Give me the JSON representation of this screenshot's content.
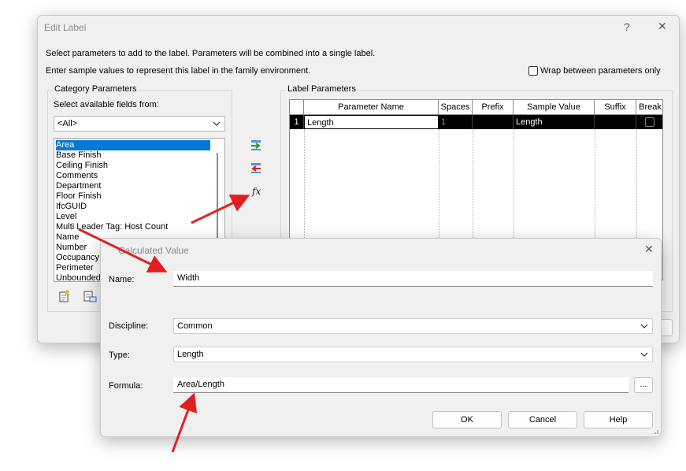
{
  "edit_label": {
    "title": "Edit Label",
    "help": "?",
    "close": "✕",
    "instruction1": "Select parameters to add to the label.  Parameters will be combined into a single label.",
    "instruction2": "Enter sample values to represent this label in the family environment.",
    "wrap_label": "Wrap between parameters only",
    "category_group": "Category Parameters",
    "select_fields_label": "Select available fields from:",
    "fields_from": "<All>",
    "parameters": [
      "Area",
      "Base Finish",
      "Ceiling Finish",
      "Comments",
      "Department",
      "Floor Finish",
      "IfcGUID",
      "Level",
      "Multi Leader Tag: Host Count",
      "Name",
      "Number",
      "Occupancy",
      "Perimeter",
      "Unbounded"
    ],
    "label_group": "Label Parameters",
    "columns": [
      "",
      "Parameter Name",
      "Spaces",
      "Prefix",
      "Sample Value",
      "Suffix",
      "Break"
    ],
    "rows": [
      {
        "index": "1",
        "parameter_name": "Length",
        "spaces": "1",
        "prefix": "",
        "sample_value": "Length",
        "suffix": ""
      }
    ],
    "fx_icon": "fx-icon"
  },
  "calculated_value": {
    "title": "Calculated Value",
    "close": "✕",
    "name_label": "Name:",
    "name_value": "Width",
    "discipline_label": "Discipline:",
    "discipline_value": "Common",
    "type_label": "Type:",
    "type_value": "Length",
    "formula_label": "Formula:",
    "formula_value": "Area/Length",
    "browse_label": "...",
    "ok_label": "OK",
    "cancel_label": "Cancel",
    "help_label": "Help"
  },
  "colors": {
    "selection": "#0078d7",
    "arrow": "#e02020",
    "grid_row": "#000000"
  }
}
